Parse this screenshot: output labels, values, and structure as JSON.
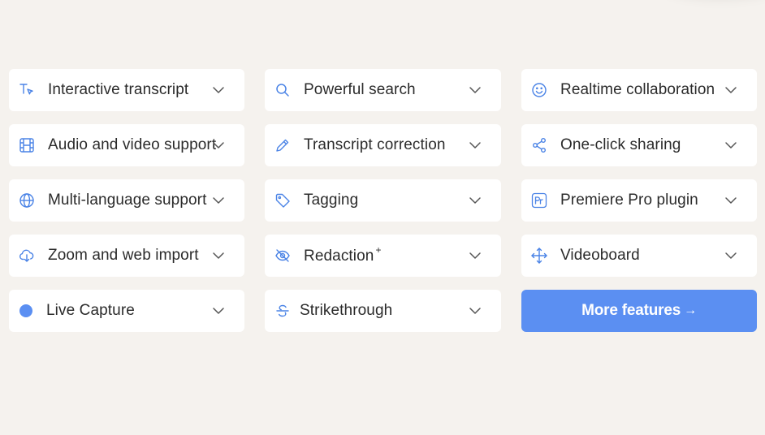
{
  "colors": {
    "background": "#f5f2ee",
    "card": "#ffffff",
    "accent": "#5b8ff2",
    "icon": "#4a83e6",
    "text": "#2b2b2b"
  },
  "features": [
    {
      "label": "Interactive transcript",
      "icon": "text-cursor-icon"
    },
    {
      "label": "Powerful search",
      "icon": "search-icon"
    },
    {
      "label": "Realtime collaboration",
      "icon": "smiley-icon"
    },
    {
      "label": "Audio and video support",
      "icon": "film-icon"
    },
    {
      "label": "Transcript correction",
      "icon": "pencil-icon"
    },
    {
      "label": "One-click sharing",
      "icon": "share-icon"
    },
    {
      "label": "Multi-language support",
      "icon": "globe-icon"
    },
    {
      "label": "Tagging",
      "icon": "tag-icon"
    },
    {
      "label": "Premiere Pro plugin",
      "icon": "premiere-pro-icon"
    },
    {
      "label": "Zoom and web import",
      "icon": "cloud-download-icon"
    },
    {
      "label": "Redaction",
      "sup": "+",
      "icon": "eye-off-icon"
    },
    {
      "label": "Videoboard",
      "icon": "move-arrows-icon"
    },
    {
      "label": "Live Capture",
      "icon": "dot-icon"
    },
    {
      "label": "Strikethrough",
      "icon": "strikethrough-icon"
    }
  ],
  "more_button": {
    "label": "More features",
    "arrow": "→"
  }
}
